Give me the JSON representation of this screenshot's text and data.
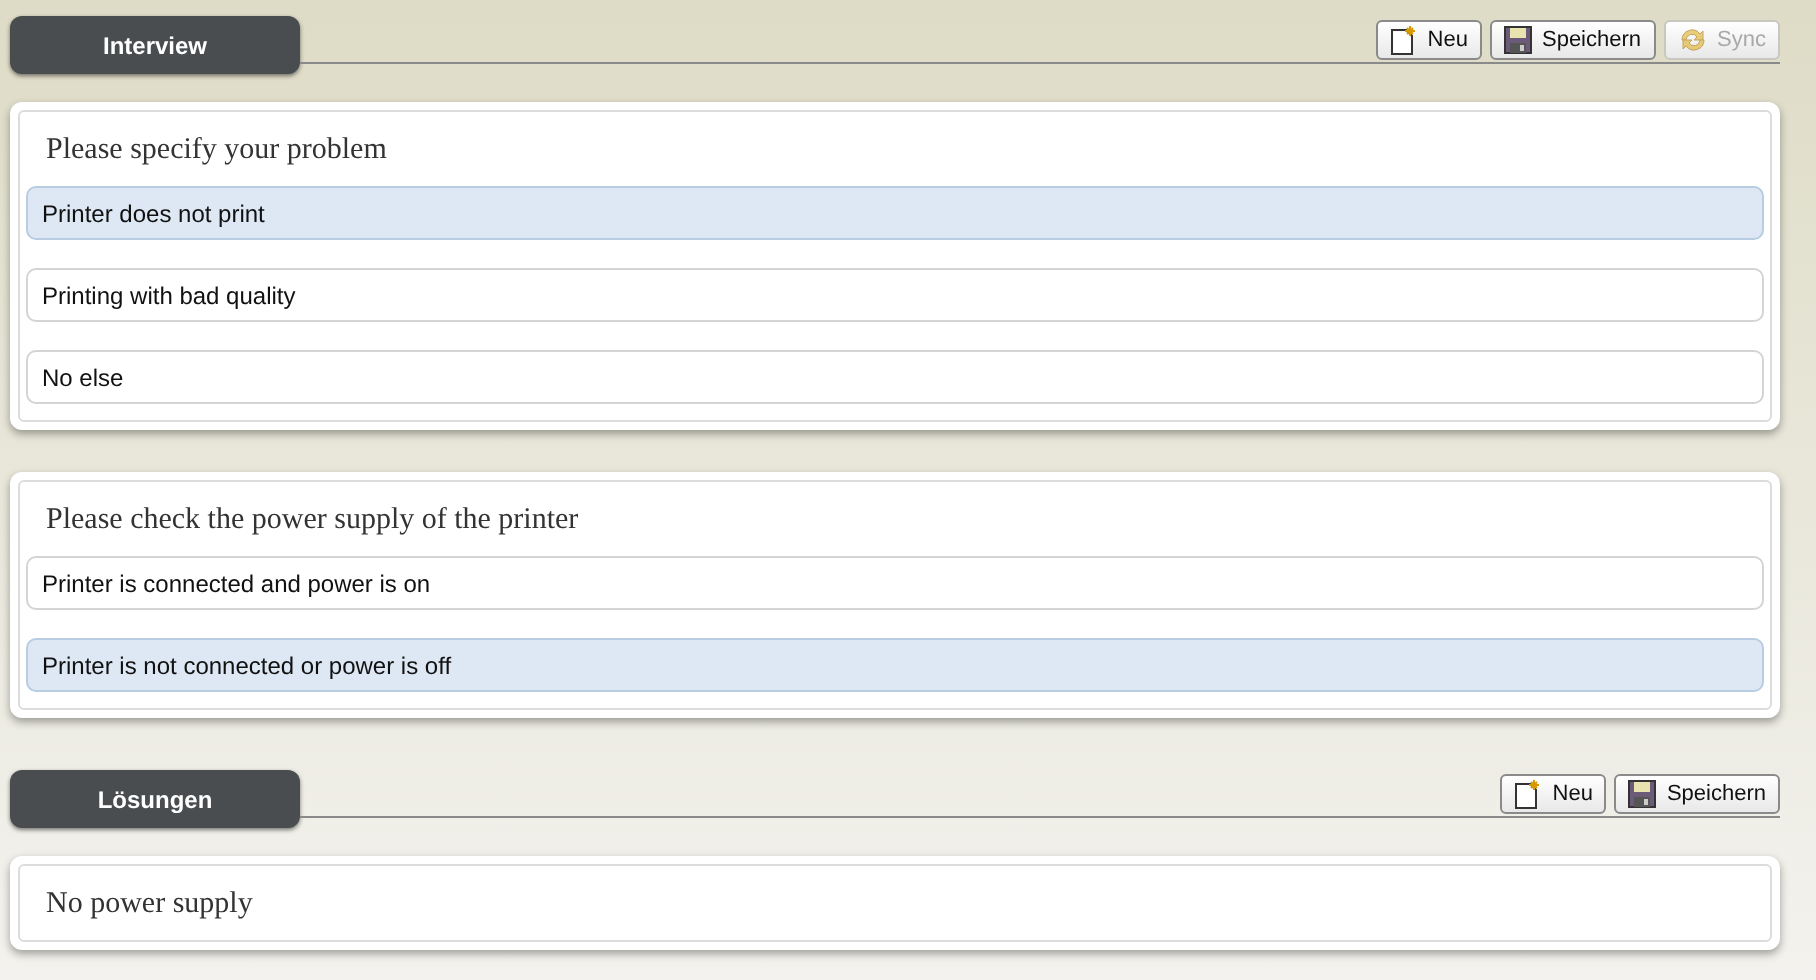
{
  "sections": [
    {
      "title": "Interview",
      "buttons": [
        {
          "kind": "new",
          "label": "Neu",
          "disabled": false
        },
        {
          "kind": "save",
          "label": "Speichern",
          "disabled": false
        },
        {
          "kind": "sync",
          "label": "Sync",
          "disabled": true
        }
      ],
      "panels": [
        {
          "question": "Please specify your problem",
          "options": [
            {
              "label": "Printer does not print",
              "selected": true
            },
            {
              "label": "Printing with bad quality",
              "selected": false
            },
            {
              "label": "No else",
              "selected": false
            }
          ]
        },
        {
          "question": "Please check the power supply of the printer",
          "options": [
            {
              "label": "Printer is connected and power is on",
              "selected": false
            },
            {
              "label": "Printer is not connected or power is off",
              "selected": true
            }
          ]
        }
      ]
    },
    {
      "title": "Lösungen",
      "buttons": [
        {
          "kind": "new",
          "label": "Neu",
          "disabled": false
        },
        {
          "kind": "save",
          "label": "Speichern",
          "disabled": false
        }
      ],
      "panels": [
        {
          "question": "No power supply"
        }
      ]
    }
  ]
}
